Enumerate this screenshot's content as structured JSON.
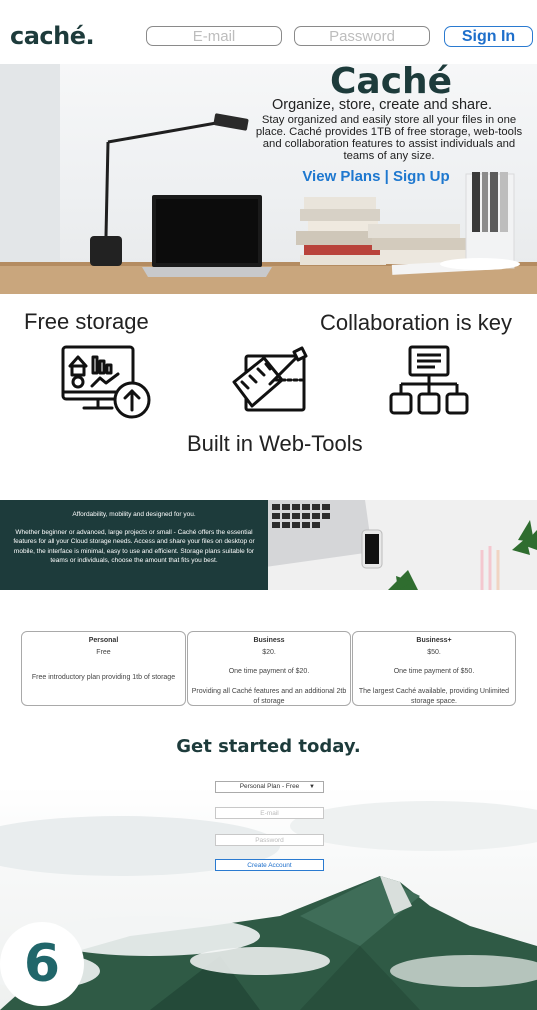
{
  "header": {
    "logo": "caché.",
    "email_placeholder": "E-mail",
    "password_placeholder": "Password",
    "signin_label": "Sign In"
  },
  "hero": {
    "title": "Caché",
    "tagline": "Organize, store, create and share.",
    "description": "Stay organized and easily store all your files in one place. Caché provides 1TB of free storage, web-tools and collaboration features to assist individuals and teams of any size.",
    "view_plans": "View Plans",
    "separator": " | ",
    "sign_up": "Sign Up"
  },
  "features": {
    "storage": "Free storage",
    "collab": "Collaboration is key",
    "webtools": "Built in Web-Tools"
  },
  "band": {
    "line1": "Affordability, mobility and designed for you.",
    "line2": "Whether beginner or advanced, large projects or small - Caché offers the essential features for all your Cloud storage needs. Access and share your files on desktop or mobile, the interface is minimal, easy to use and efficient. Storage plans suitable for teams or individuals, choose the amount that fits you best."
  },
  "plans": [
    {
      "name": "Personal",
      "price": "Free",
      "desc": "Free introductory plan providing 1tb of storage",
      "desc2": ""
    },
    {
      "name": "Business",
      "price": "$20.",
      "desc": "One time payment of $20.",
      "desc2": "Providing all Caché features and an additional 2tb of storage"
    },
    {
      "name": "Business+",
      "price": "$50.",
      "desc": "One time payment of $50.",
      "desc2": "The largest Caché available, providing Unlimited storage space."
    }
  ],
  "signup": {
    "title": "Get started today.",
    "plan_select": "Personal Plan - Free",
    "select_arrow": "▼",
    "email_placeholder": "E-mail",
    "password_placeholder": "Password",
    "create_label": "Create Account"
  },
  "badge": "6"
}
